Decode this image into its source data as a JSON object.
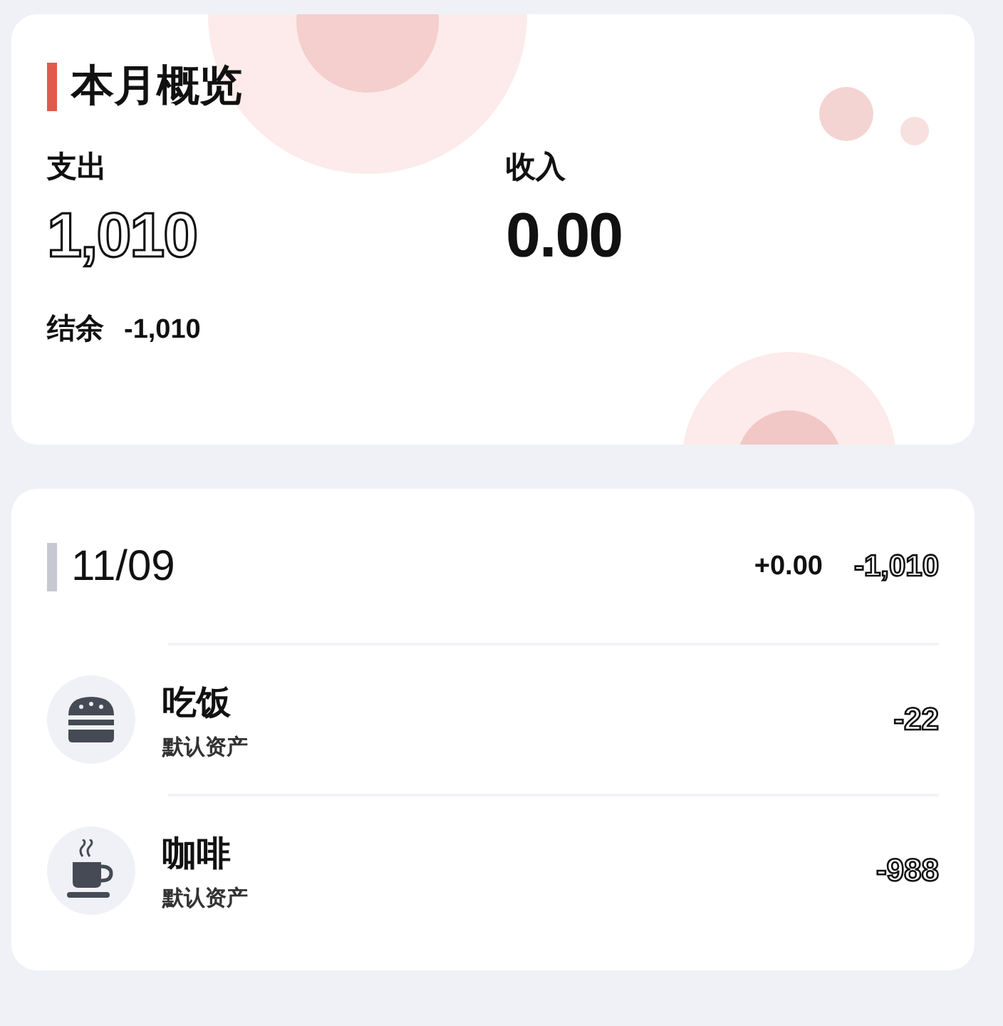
{
  "summary": {
    "title": "本月概览",
    "expense": {
      "label": "支出",
      "value": "1,010"
    },
    "income": {
      "label": "收入",
      "value": "0.00"
    },
    "balance": {
      "label": "结余",
      "value": "-1,010"
    }
  },
  "day": {
    "date": "11/09",
    "income": "+0.00",
    "expense": "-1,010",
    "records": [
      {
        "kind": "meal",
        "name": "吃饭",
        "account": "默认资产",
        "amount": "-22"
      },
      {
        "kind": "drink",
        "name": "咖啡",
        "account": "默认资产",
        "amount": "-988"
      }
    ]
  }
}
